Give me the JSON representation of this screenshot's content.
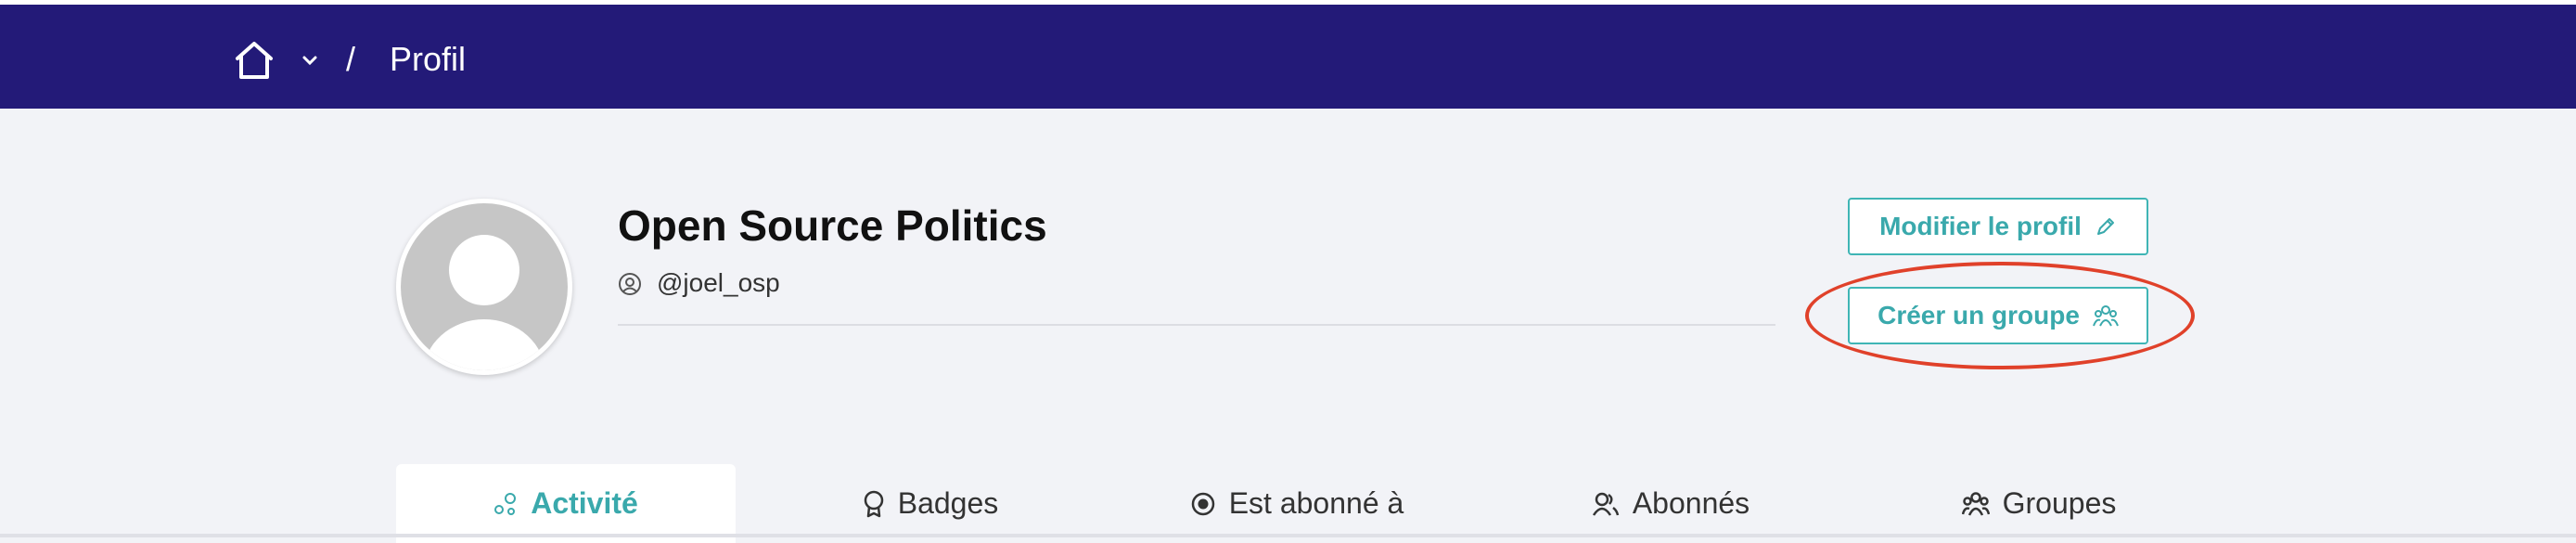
{
  "header": {
    "breadcrumb_separator": "/",
    "breadcrumb_current": "Profil",
    "home_icon": "home-icon",
    "dropdown_icon": "chevron-down-icon"
  },
  "profile": {
    "name": "Open Source Politics",
    "handle": "@joel_osp"
  },
  "actions": {
    "edit_label": "Modifier le profil",
    "create_group_label": "Créer un groupe"
  },
  "tabs": [
    {
      "label": "Activité",
      "icon": "activity-icon",
      "active": true
    },
    {
      "label": "Badges",
      "icon": "badge-icon",
      "active": false
    },
    {
      "label": "Est abonné à",
      "icon": "eye-icon",
      "active": false
    },
    {
      "label": "Abonnés",
      "icon": "followers-icon",
      "active": false
    },
    {
      "label": "Groupes",
      "icon": "groups-icon",
      "active": false
    }
  ],
  "colors": {
    "header_bg": "#231a78",
    "accent": "#3aa9ac",
    "highlight": "#e0412a",
    "page_bg": "#f2f3f7"
  }
}
